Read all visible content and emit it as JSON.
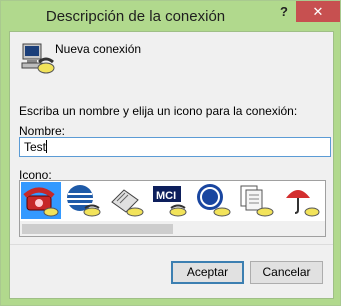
{
  "window": {
    "title": "Descripción de la conexión",
    "help_label": "?",
    "close_label": "✕"
  },
  "header": {
    "connection_name": "Nueva conexión",
    "app_icon": "phone-computer-icon"
  },
  "form": {
    "instructions": "Escriba un nombre y elija un icono para la conexión:",
    "name_label": "Nombre:",
    "name_value": "Test",
    "icon_label": "Icono:"
  },
  "icons": [
    {
      "name": "red-phone-icon",
      "selected": true
    },
    {
      "name": "globe-phone-icon",
      "selected": false
    },
    {
      "name": "fax-phone-icon",
      "selected": false
    },
    {
      "name": "mci-logo-icon",
      "selected": false
    },
    {
      "name": "ge-logo-icon",
      "selected": false
    },
    {
      "name": "documents-phone-icon",
      "selected": false
    },
    {
      "name": "umbrella-phone-icon",
      "selected": false
    }
  ],
  "buttons": {
    "accept": "Aceptar",
    "cancel": "Cancelar"
  },
  "colors": {
    "frame": "#b1d98d",
    "close": "#c75050",
    "selection": "#3399ff",
    "input_border": "#5b9bd5"
  }
}
